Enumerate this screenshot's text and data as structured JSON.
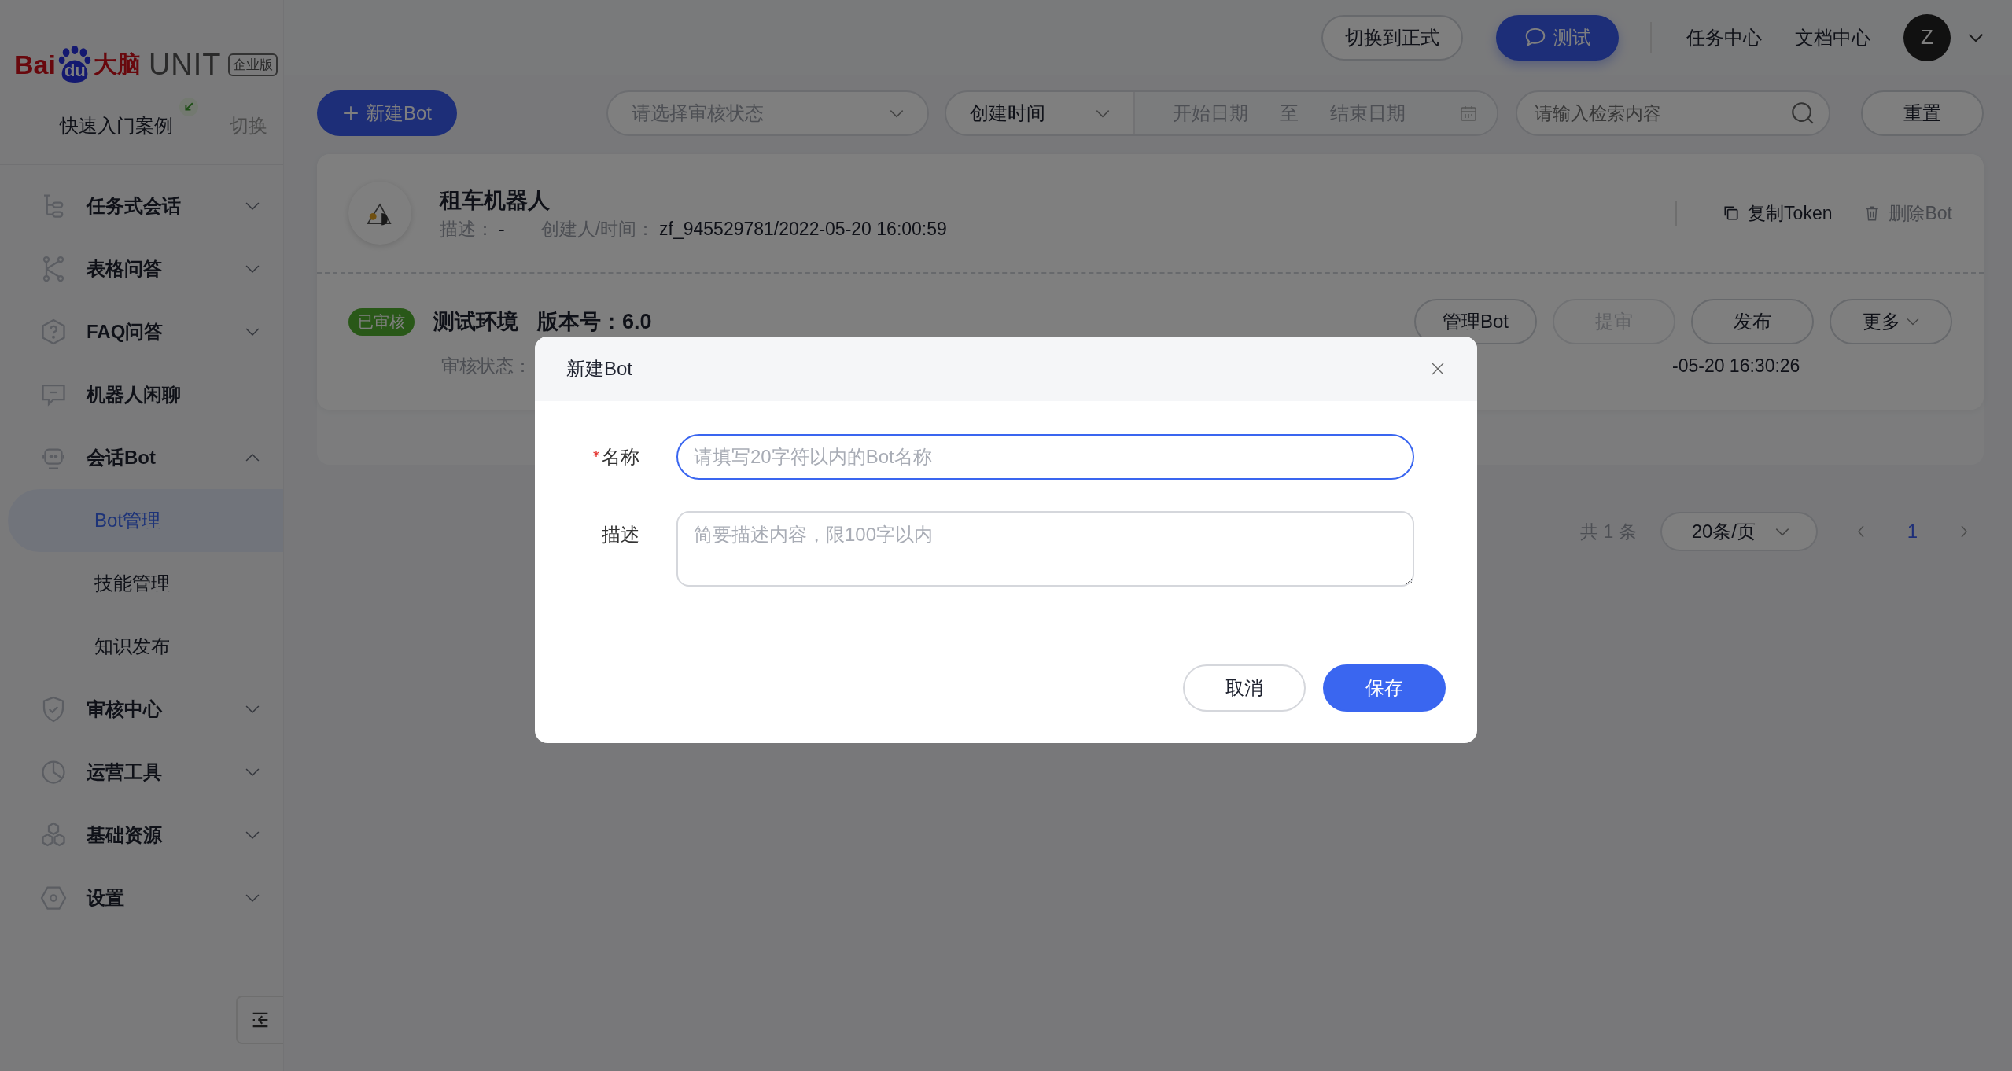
{
  "logo": {
    "brand": "Bai",
    "paw_text": "du",
    "brand_cn": "大脑",
    "product": "UNIT",
    "edition": "企业版"
  },
  "quick_start": {
    "label": "快速入门案例",
    "switch": "切换"
  },
  "sidebar": {
    "items": [
      {
        "label": "任务式会话",
        "kind": "group",
        "expanded": false,
        "selected": false
      },
      {
        "label": "表格问答",
        "kind": "group",
        "expanded": false,
        "selected": false
      },
      {
        "label": "FAQ问答",
        "kind": "group",
        "expanded": false,
        "selected": false
      },
      {
        "label": "机器人闲聊",
        "kind": "link",
        "selected": false
      },
      {
        "label": "会话Bot",
        "kind": "group",
        "expanded": true,
        "selected": false,
        "children": [
          {
            "label": "Bot管理",
            "selected": true
          },
          {
            "label": "技能管理",
            "selected": false
          },
          {
            "label": "知识发布",
            "selected": false
          }
        ]
      },
      {
        "label": "审核中心",
        "kind": "group",
        "expanded": false,
        "selected": false
      },
      {
        "label": "运营工具",
        "kind": "group",
        "expanded": false,
        "selected": false
      },
      {
        "label": "基础资源",
        "kind": "group",
        "expanded": false,
        "selected": false
      },
      {
        "label": "设置",
        "kind": "group",
        "expanded": false,
        "selected": false
      }
    ]
  },
  "topbar": {
    "switch_button": "切换到正式",
    "test_button": "测试",
    "links": [
      "任务中心",
      "文档中心"
    ],
    "avatar": "Z"
  },
  "toolbar": {
    "new_button": "新建Bot",
    "status_select": {
      "placeholder": "请选择审核状态"
    },
    "time_select": "创建时间",
    "start_date": {
      "placeholder": "开始日期"
    },
    "range_separator": "至",
    "end_date": {
      "placeholder": "结束日期"
    },
    "search": {
      "placeholder": "请输入检索内容"
    },
    "reset_button": "重置"
  },
  "bot_card": {
    "name": "租车机器人",
    "desc_label": "描述：",
    "desc_value": "-",
    "creator_label": "创建人/时间：",
    "creator_value": "zf_945529781/2022-05-20 16:00:59",
    "actions": [
      {
        "label": "复制Token",
        "kind": "copy",
        "disabled": false
      },
      {
        "label": "删除Bot",
        "kind": "delete",
        "disabled": true
      }
    ],
    "env": {
      "status_tag": "已审核",
      "name": "测试环境",
      "version_label": "版本号：",
      "version": "6.0",
      "buttons": [
        {
          "label": "管理Bot",
          "kind": "plain",
          "disabled": false
        },
        {
          "label": "提审",
          "kind": "plain",
          "disabled": true
        },
        {
          "label": "发布",
          "kind": "plain",
          "disabled": false
        },
        {
          "label": "更多",
          "kind": "dropdown",
          "disabled": false
        }
      ],
      "audit_label": "审核状态：",
      "time_value": "-05-20 16:30:26"
    }
  },
  "pagination": {
    "total": "共 1 条",
    "page_size": "20条/页",
    "pages": [
      {
        "label": "1",
        "selected": true
      }
    ]
  },
  "dialog": {
    "title": "新建Bot",
    "fields": [
      {
        "kind": "input",
        "label": "名称",
        "required": true,
        "placeholder": "请填写20字符以内的Bot名称",
        "focused": true
      },
      {
        "kind": "textarea",
        "label": "描述",
        "required": false,
        "placeholder": "简要描述内容，限100字以内",
        "focused": false
      }
    ],
    "buttons": [
      {
        "label": "取消",
        "kind": "secondary"
      },
      {
        "label": "保存",
        "kind": "primary"
      }
    ]
  }
}
